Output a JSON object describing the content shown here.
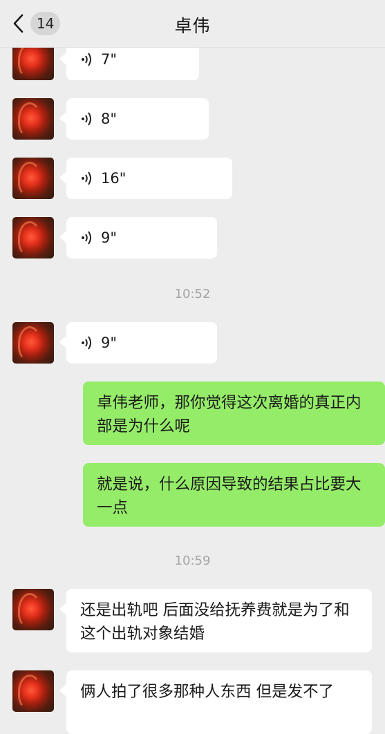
{
  "header": {
    "unread_count": "14",
    "title": "卓伟"
  },
  "messages": {
    "voice1_duration": "7\"",
    "voice2_duration": "8\"",
    "voice3_duration": "16\"",
    "voice4_duration": "9\"",
    "time1": "10:52",
    "voice5_duration": "9\"",
    "out1_text": "卓伟老师，那你觉得这次离婚的真正内部是为什么呢",
    "out2_text": "就是说，什么原因导致的结果占比要大一点",
    "time2": "10:59",
    "in1_text": "还是出轨吧 后面没给抚养费就是为了和这个出轨对象结婚",
    "in2_text": "俩人拍了很多那种人东西 但是发不了"
  },
  "colors": {
    "background": "#ededed",
    "incoming_bubble": "#ffffff",
    "outgoing_bubble": "#95ec69",
    "timestamp": "#a5a5a5"
  },
  "icons": {
    "back": "chevron-left-icon",
    "voice": "voice-wave-icon"
  }
}
